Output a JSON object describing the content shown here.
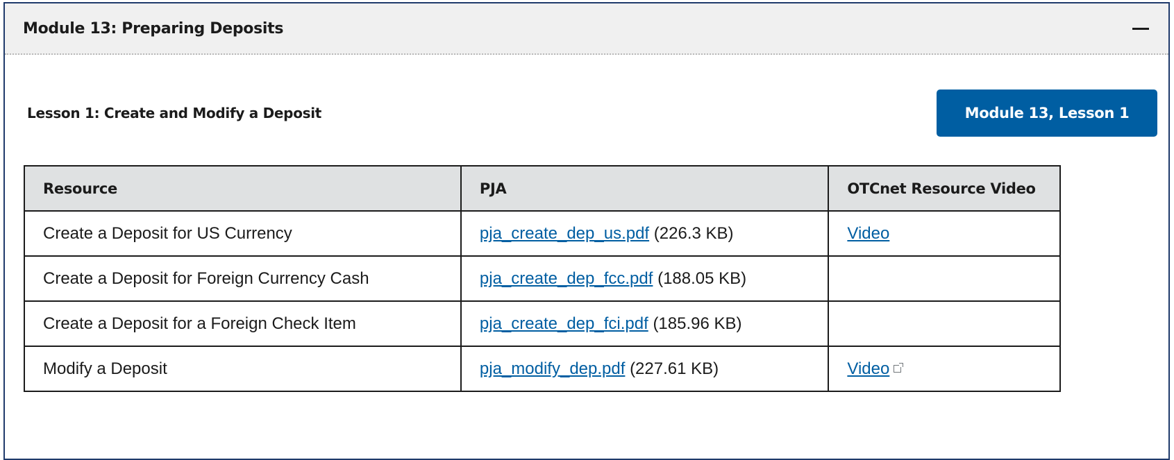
{
  "module": {
    "title": "Module 13: Preparing Deposits",
    "toggle_icon": "minus-icon"
  },
  "lesson": {
    "title": "Lesson 1: Create and Modify a Deposit",
    "button_label": "Module 13, Lesson 1"
  },
  "table": {
    "headers": [
      "Resource",
      "PJA",
      "OTCnet Resource Video"
    ],
    "rows": [
      {
        "resource": "Create a Deposit for US Currency",
        "pja_link": "pja_create_dep_us.pdf",
        "pja_size": "(226.3 KB)",
        "video": "Video",
        "video_external": false
      },
      {
        "resource": "Create a Deposit for Foreign Currency Cash",
        "pja_link": "pja_create_dep_fcc.pdf",
        "pja_size": "(188.05 KB)",
        "video": "",
        "video_external": false
      },
      {
        "resource": "Create a Deposit for a Foreign Check Item",
        "pja_link": "pja_create_dep_fci.pdf",
        "pja_size": "(185.96 KB)",
        "video": "",
        "video_external": false
      },
      {
        "resource": "Modify a Deposit",
        "pja_link": "pja_modify_dep.pdf",
        "pja_size": "(227.61 KB)",
        "video": "Video",
        "video_external": true
      }
    ]
  },
  "colors": {
    "border": "#1f3a6b",
    "button_bg": "#005ea2",
    "link": "#005ea2",
    "header_bg": "#f0f0f0",
    "table_header_bg": "#dfe1e2"
  }
}
